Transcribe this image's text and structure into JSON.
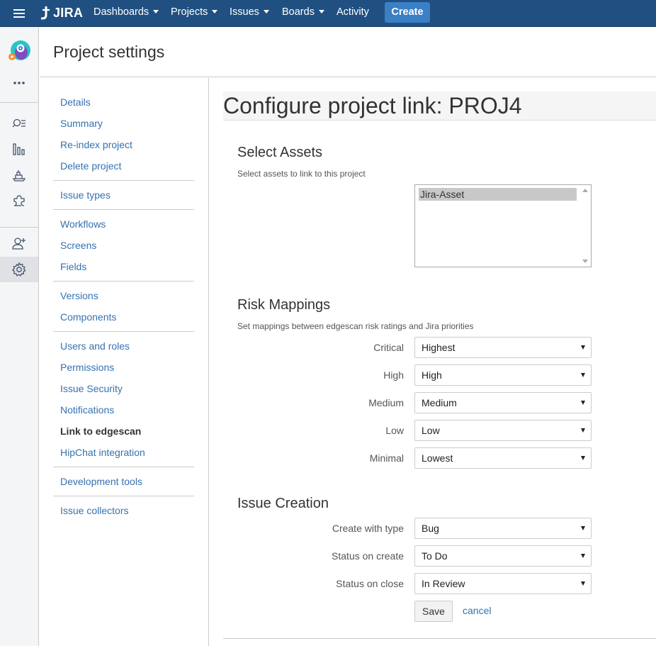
{
  "topnav": {
    "logo": "JIRA",
    "items": [
      {
        "label": "Dashboards",
        "dropdown": true
      },
      {
        "label": "Projects",
        "dropdown": true
      },
      {
        "label": "Issues",
        "dropdown": true
      },
      {
        "label": "Boards",
        "dropdown": true
      },
      {
        "label": "Activity",
        "dropdown": false
      }
    ],
    "create_label": "Create"
  },
  "sidebar": {
    "icons": [
      "project-avatar-icon",
      "more-icon",
      "search-issues-icon",
      "reports-icon",
      "releases-icon",
      "add-ons-icon",
      "add-user-icon",
      "settings-icon"
    ],
    "active": "settings-icon"
  },
  "page": {
    "title": "Project settings"
  },
  "projnav": {
    "items": [
      "Details",
      "Summary",
      "Re-index project",
      "Delete project",
      "Issue types",
      "Workflows",
      "Screens",
      "Fields",
      "Versions",
      "Components",
      "Users and roles",
      "Permissions",
      "Issue Security",
      "Notifications",
      "Link to edgescan",
      "HipChat integration",
      "Development tools",
      "Issue collectors"
    ],
    "selected": "Link to edgescan"
  },
  "main": {
    "title": "Configure project link: PROJ4",
    "assets": {
      "heading": "Select Assets",
      "description": "Select assets to link to this project",
      "options": [
        "Jira-Asset"
      ],
      "selected": "Jira-Asset"
    },
    "risk": {
      "heading": "Risk Mappings",
      "description": "Set mappings between edgescan risk ratings and Jira priorities",
      "rows": [
        {
          "label": "Critical",
          "value": "Highest"
        },
        {
          "label": "High",
          "value": "High"
        },
        {
          "label": "Medium",
          "value": "Medium"
        },
        {
          "label": "Low",
          "value": "Low"
        },
        {
          "label": "Minimal",
          "value": "Lowest"
        }
      ]
    },
    "issue_creation": {
      "heading": "Issue Creation",
      "rows": [
        {
          "label": "Create with type",
          "value": "Bug"
        },
        {
          "label": "Status on create",
          "value": "To Do"
        },
        {
          "label": "Status on close",
          "value": "In Review"
        }
      ]
    },
    "save_label": "Save",
    "cancel_label": "cancel"
  },
  "colors": {
    "nav_bg": "#205081",
    "create_button": "#3b7fc4",
    "link": "#3572b0"
  }
}
